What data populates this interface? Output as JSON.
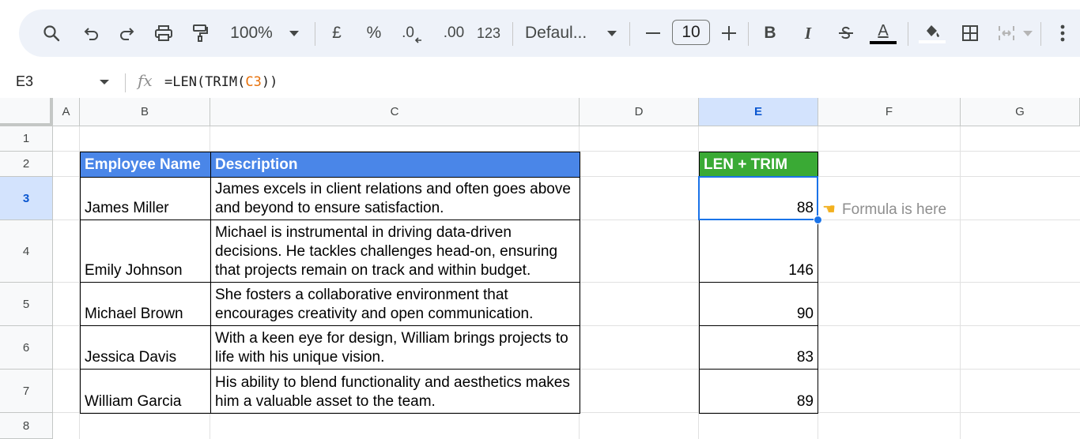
{
  "toolbar": {
    "zoom": "100%",
    "currency": "£",
    "percent": "%",
    "decrease_decimal": ".0",
    "increase_decimal": ".00",
    "number_format": "123",
    "font_name": "Defaul...",
    "font_size": "10",
    "bold": "B",
    "italic": "I",
    "text_color_letter": "A"
  },
  "formula_bar": {
    "cell_ref": "E3",
    "fx": "fx",
    "formula_prefix": "=LEN(TRIM(",
    "formula_ref": "C3",
    "formula_suffix": "))"
  },
  "columns": [
    "A",
    "B",
    "C",
    "D",
    "E",
    "F",
    "G"
  ],
  "rows": [
    "1",
    "2",
    "3",
    "4",
    "5",
    "6",
    "7",
    "8"
  ],
  "selected_column": "E",
  "selected_row": "3",
  "table": {
    "header_name": "Employee Name",
    "header_desc": "Description",
    "header_len": "LEN + TRIM",
    "rows": [
      {
        "name": "James Miller",
        "desc": "James excels in client relations and often goes above and beyond to ensure satisfaction.",
        "len": "88"
      },
      {
        "name": "Emily Johnson",
        "desc": "Michael is instrumental in driving data-driven decisions. He tackles challenges head-on, ensuring that projects remain on track and within budget.",
        "len": "146"
      },
      {
        "name": "Michael Brown",
        "desc": "She fosters a collaborative environment that encourages creativity and open communication.",
        "len": "90"
      },
      {
        "name": "Jessica Davis",
        "desc": "With a keen eye for design, William brings projects to life with his unique vision.",
        "len": "83"
      },
      {
        "name": "William Garcia",
        "desc": "His ability to blend functionality and aesthetics makes him a valuable asset to the team.",
        "len": "89"
      }
    ]
  },
  "annotation": {
    "text": "Formula is here",
    "icon": "pointing-hand-icon"
  },
  "colors": {
    "header_blue": "#4a86e8",
    "header_green": "#3aaa35",
    "selection": "#1a73e8"
  }
}
